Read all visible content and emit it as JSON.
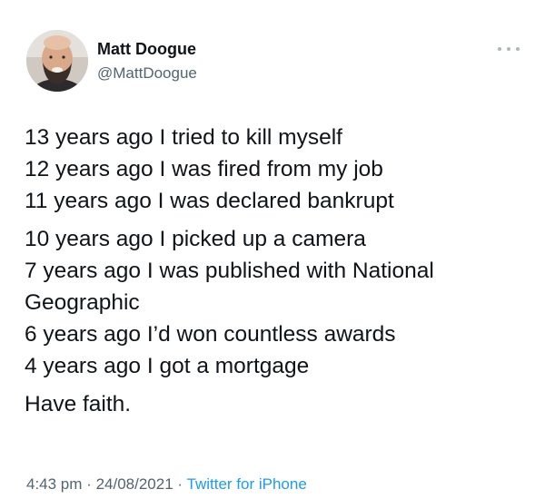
{
  "author": {
    "name": "Matt Doogue",
    "handle": "@MattDoogue",
    "avatar": "profile-photo-bearded-man"
  },
  "more_icon": "ellipsis-icon",
  "tweet": {
    "lines_group1": [
      "13 years ago I tried to kill myself",
      "12 years ago I was fired from my job",
      "11 years ago I was declared bankrupt"
    ],
    "lines_group2": [
      "10 years ago I picked up a camera",
      "7 years ago I was published with National",
      "Geographic",
      "6 years ago I’d won countless awards",
      "4 years ago I got a mortgage"
    ],
    "closing": "Have faith."
  },
  "footer": {
    "time": "4:43 pm",
    "separator": "·",
    "date": "24/08/2021",
    "source": "Twitter for iPhone"
  },
  "colors": {
    "text": "#0f1419",
    "secondary": "#536471",
    "link": "#1d9bf0"
  }
}
